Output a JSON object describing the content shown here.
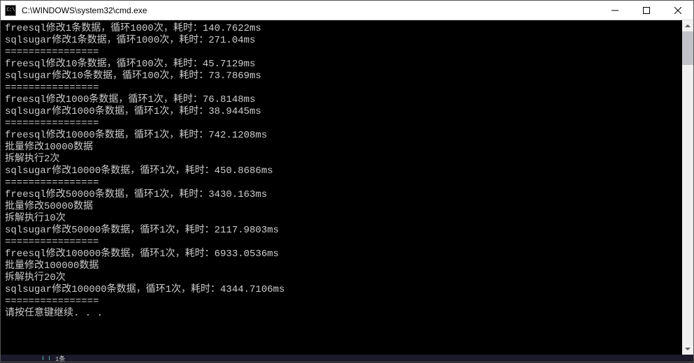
{
  "window": {
    "icon_text": "C:\\",
    "title": "C:\\WINDOWS\\system32\\cmd.exe"
  },
  "console": {
    "lines": [
      "freesql修改1条数据，循环1000次，耗时：140.7622ms",
      "sqlsugar修改1条数据，循环1000次，耗时：271.04ms",
      "================",
      "freesql修改10条数据，循环100次，耗时：45.7129ms",
      "sqlsugar修改10条数据，循环100次，耗时：73.7869ms",
      "================",
      "freesql修改1000条数据，循环1次，耗时：76.8148ms",
      "sqlsugar修改1000条数据，循环1次，耗时：38.9445ms",
      "================",
      "freesql修改10000条数据，循环1次，耗时：742.1208ms",
      "批量修改10000数据",
      "拆解执行2次",
      "sqlsugar修改10000条数据，循环1次，耗时：450.8686ms",
      "================",
      "freesql修改50000条数据，循环1次，耗时：3430.163ms",
      "批量修改50000数据",
      "拆解执行10次",
      "sqlsugar修改50000条数据，循环1次，耗时：2117.9803ms",
      "================",
      "freesql修改100000条数据，循环1次，耗时：6933.0536ms",
      "批量修改100000数据",
      "拆解执行20次",
      "sqlsugar修改100000条数据，循环1次，耗时：4344.7106ms",
      "================",
      "请按任意键继续. . ."
    ]
  },
  "bottom": {
    "text": "1条"
  }
}
